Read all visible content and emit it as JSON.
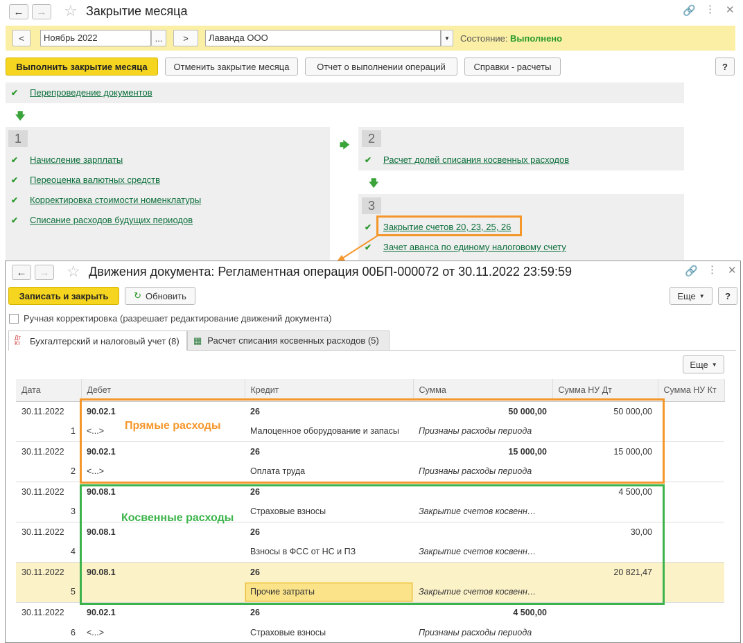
{
  "win1": {
    "title": "Закрытие месяца",
    "period": "Ноябрь 2022",
    "org": "Лаванда ООО",
    "state_label": "Состояние:",
    "state_value": "Выполнено",
    "btn_prev": "<",
    "btn_next": ">",
    "btn_dots": "...",
    "buttons": {
      "run": "Выполнить закрытие месяца",
      "cancel": "Отменить закрытие месяца",
      "report": "Отчет о выполнении операций",
      "refs": "Справки - расчеты",
      "help": "?"
    },
    "repost": "Перепроведение документов",
    "step1": {
      "num": "1",
      "items": [
        "Начисление зарплаты",
        "Переоценка валютных средств",
        "Корректировка стоимости номенклатуры",
        "Списание расходов будущих периодов"
      ]
    },
    "step2": {
      "num": "2",
      "items": [
        "Расчет долей списания косвенных расходов"
      ]
    },
    "step3": {
      "num": "3",
      "items": [
        "Закрытие счетов 20, 23, 25, 26",
        "Зачет аванса по единому налоговому счету"
      ]
    }
  },
  "win2": {
    "title": "Движения документа: Регламентная операция 00БП-000072 от 30.11.2022 23:59:59",
    "btn_save": "Записать и закрыть",
    "btn_refresh": "Обновить",
    "btn_more": "Еще",
    "btn_help": "?",
    "manual": "Ручная корректировка (разрешает редактирование движений документа)",
    "tab1": "Бухгалтерский и налоговый учет (8)",
    "tab1_icon": "Дт Кт",
    "tab2": "Расчет списания косвенных расходов (5)",
    "columns": [
      "Дата",
      "Дебет",
      "Кредит",
      "Сумма",
      "Сумма НУ Дт",
      "Сумма НУ Кт"
    ],
    "rows": [
      {
        "date": "30.11.2022",
        "n": "1",
        "debit": "90.02.1",
        "debit2": "<...>",
        "credit": "26",
        "credit2": "Малоценное оборудование и запасы",
        "sum": "50 000,00",
        "content": "Признаны расходы периода",
        "nu_dt": "50 000,00"
      },
      {
        "date": "30.11.2022",
        "n": "2",
        "debit": "90.02.1",
        "debit2": "<...>",
        "credit": "26",
        "credit2": "Оплата труда",
        "sum": "15 000,00",
        "content": "Признаны расходы периода",
        "nu_dt": "15 000,00"
      },
      {
        "date": "30.11.2022",
        "n": "3",
        "debit": "90.08.1",
        "debit2": "",
        "credit": "26",
        "credit2": "Страховые взносы",
        "sum": "",
        "content": "Закрытие счетов косвенн…",
        "nu_dt": "4 500,00"
      },
      {
        "date": "30.11.2022",
        "n": "4",
        "debit": "90.08.1",
        "debit2": "",
        "credit": "26",
        "credit2": "Взносы в ФСС от НС и ПЗ",
        "sum": "",
        "content": "Закрытие счетов косвенн…",
        "nu_dt": "30,00"
      },
      {
        "date": "30.11.2022",
        "n": "5",
        "debit": "90.08.1",
        "debit2": "",
        "credit": "26",
        "credit2": "Прочие затраты",
        "sum": "",
        "content": "Закрытие счетов косвенн…",
        "nu_dt": "20 821,47"
      },
      {
        "date": "30.11.2022",
        "n": "6",
        "debit": "90.02.1",
        "debit2": "<...>",
        "credit": "26",
        "credit2": "Страховые взносы",
        "sum": "4 500,00",
        "content": "Признаны расходы периода",
        "nu_dt": ""
      }
    ]
  },
  "annotations": {
    "direct": "Прямые расходы",
    "indirect": "Косвенные расходы",
    "orange": "#f5962a",
    "green": "#3cb44b"
  }
}
